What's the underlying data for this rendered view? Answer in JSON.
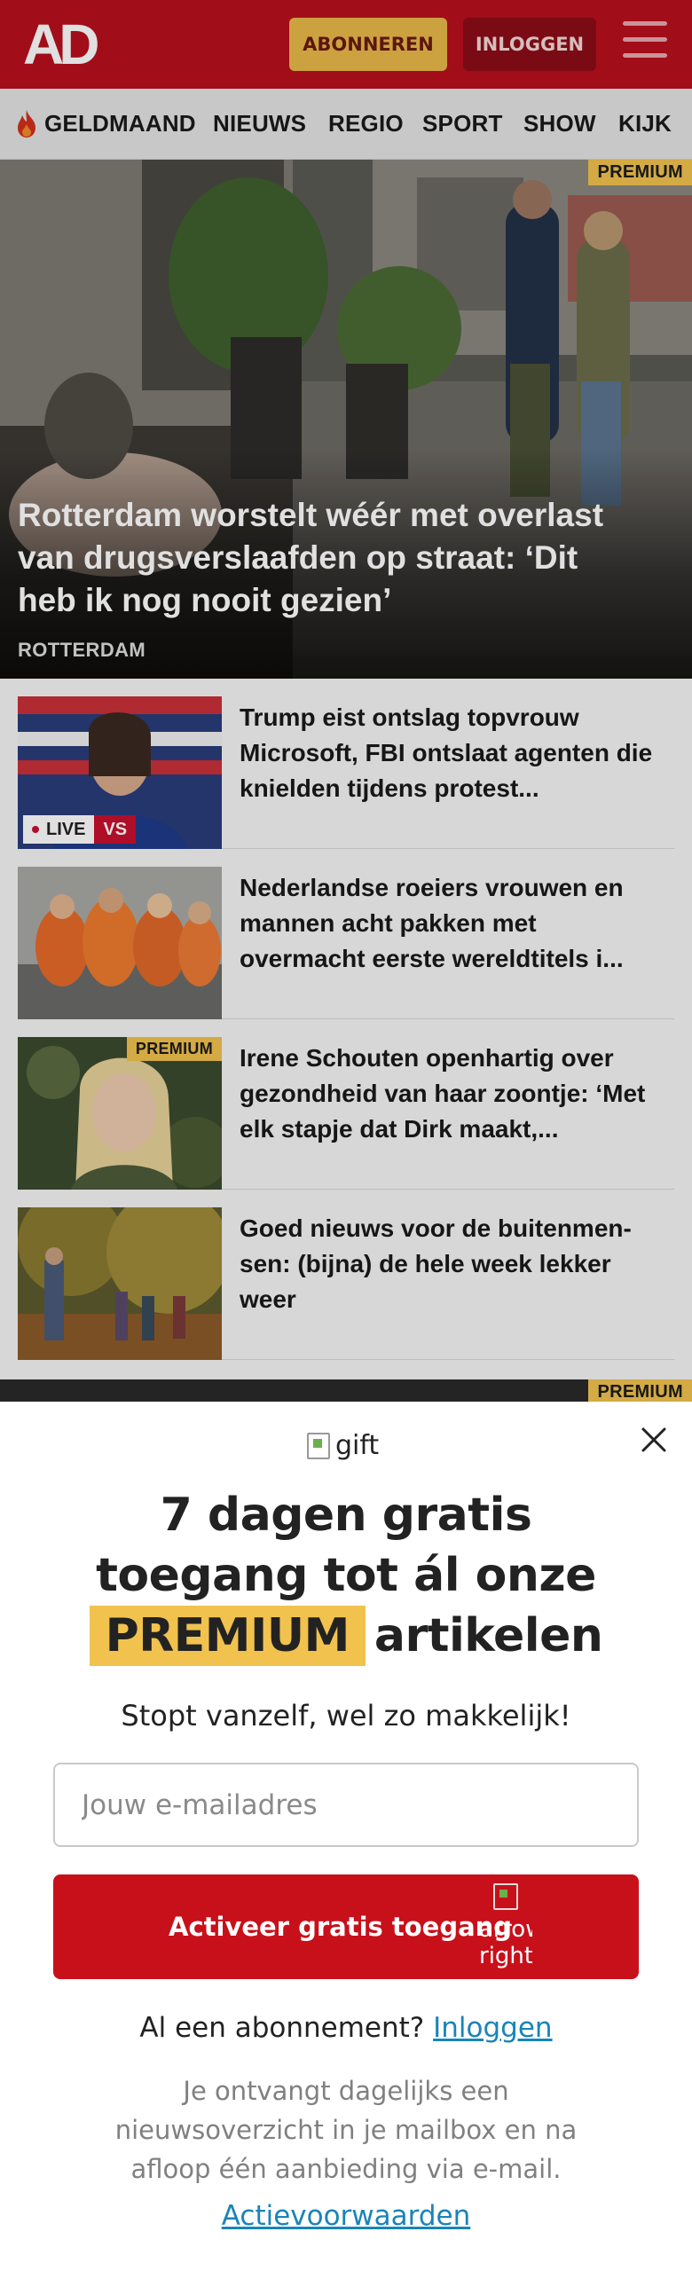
{
  "header": {
    "logo_text": "AD",
    "subscribe_label": "ABONNEREN",
    "login_label": "INLOGGEN",
    "menu_icon": "hamburger-icon"
  },
  "nav": {
    "items": [
      "GELDMAAND",
      "NIEUWS",
      "REGIO",
      "SPORT",
      "SHOW",
      "KIJK"
    ],
    "featured_icon": "flame-icon"
  },
  "hero": {
    "badge": "PREMIUM",
    "title": "Rotterdam worstelt wéér met overlast van drugsverslaafden op straat: ‘Dit heb ik nog nooit gezien’",
    "kicker": "ROTTERDAM"
  },
  "articles": [
    {
      "title": "Trump eist ontslag topvrouw Microsoft, FBI ontslaat agenten die knielden tijdens protest...",
      "live_label": "LIVE",
      "live_tag": "VS"
    },
    {
      "title": "Nederlandse roeiers vrouwen en mannen acht pakken met overmacht eerste wereldtitels i..."
    },
    {
      "badge": "PREMIUM",
      "title": "Irene Schouten openhartig over gezondheid van haar zoontje: ‘Met elk stapje dat Dirk maakt,..."
    },
    {
      "title": "Goed nieuws voor de buitenmen-sen: (bijna) de hele week lekker weer"
    }
  ],
  "peek_badge": "PREMIUM",
  "modal": {
    "gift_alt": "gift",
    "headline_line1": "7 dagen gratis",
    "headline_line2": "toegang tot ál onze",
    "headline_premium": "PREMIUM",
    "headline_line3_rest": "artikelen",
    "subline": "Stopt vanzelf, wel zo makkelijk!",
    "email_placeholder": "Jouw e-mailadres",
    "cta_label": "Activeer gratis toegang",
    "cta_icon_alt": "arrow-right",
    "already_text": "Al een abonnement?",
    "already_link": "Inloggen",
    "fineprint": "Je ontvangt dagelijks een nieuwsoverzicht in je mailbox en na afloop één aanbieding via e-mail.",
    "terms_link": "Actievoorwaarden"
  },
  "colors": {
    "brand_red": "#b80f1d",
    "premium_yellow": "#f1c24e",
    "cta_red": "#c8101b",
    "link_blue": "#1a84b8"
  }
}
